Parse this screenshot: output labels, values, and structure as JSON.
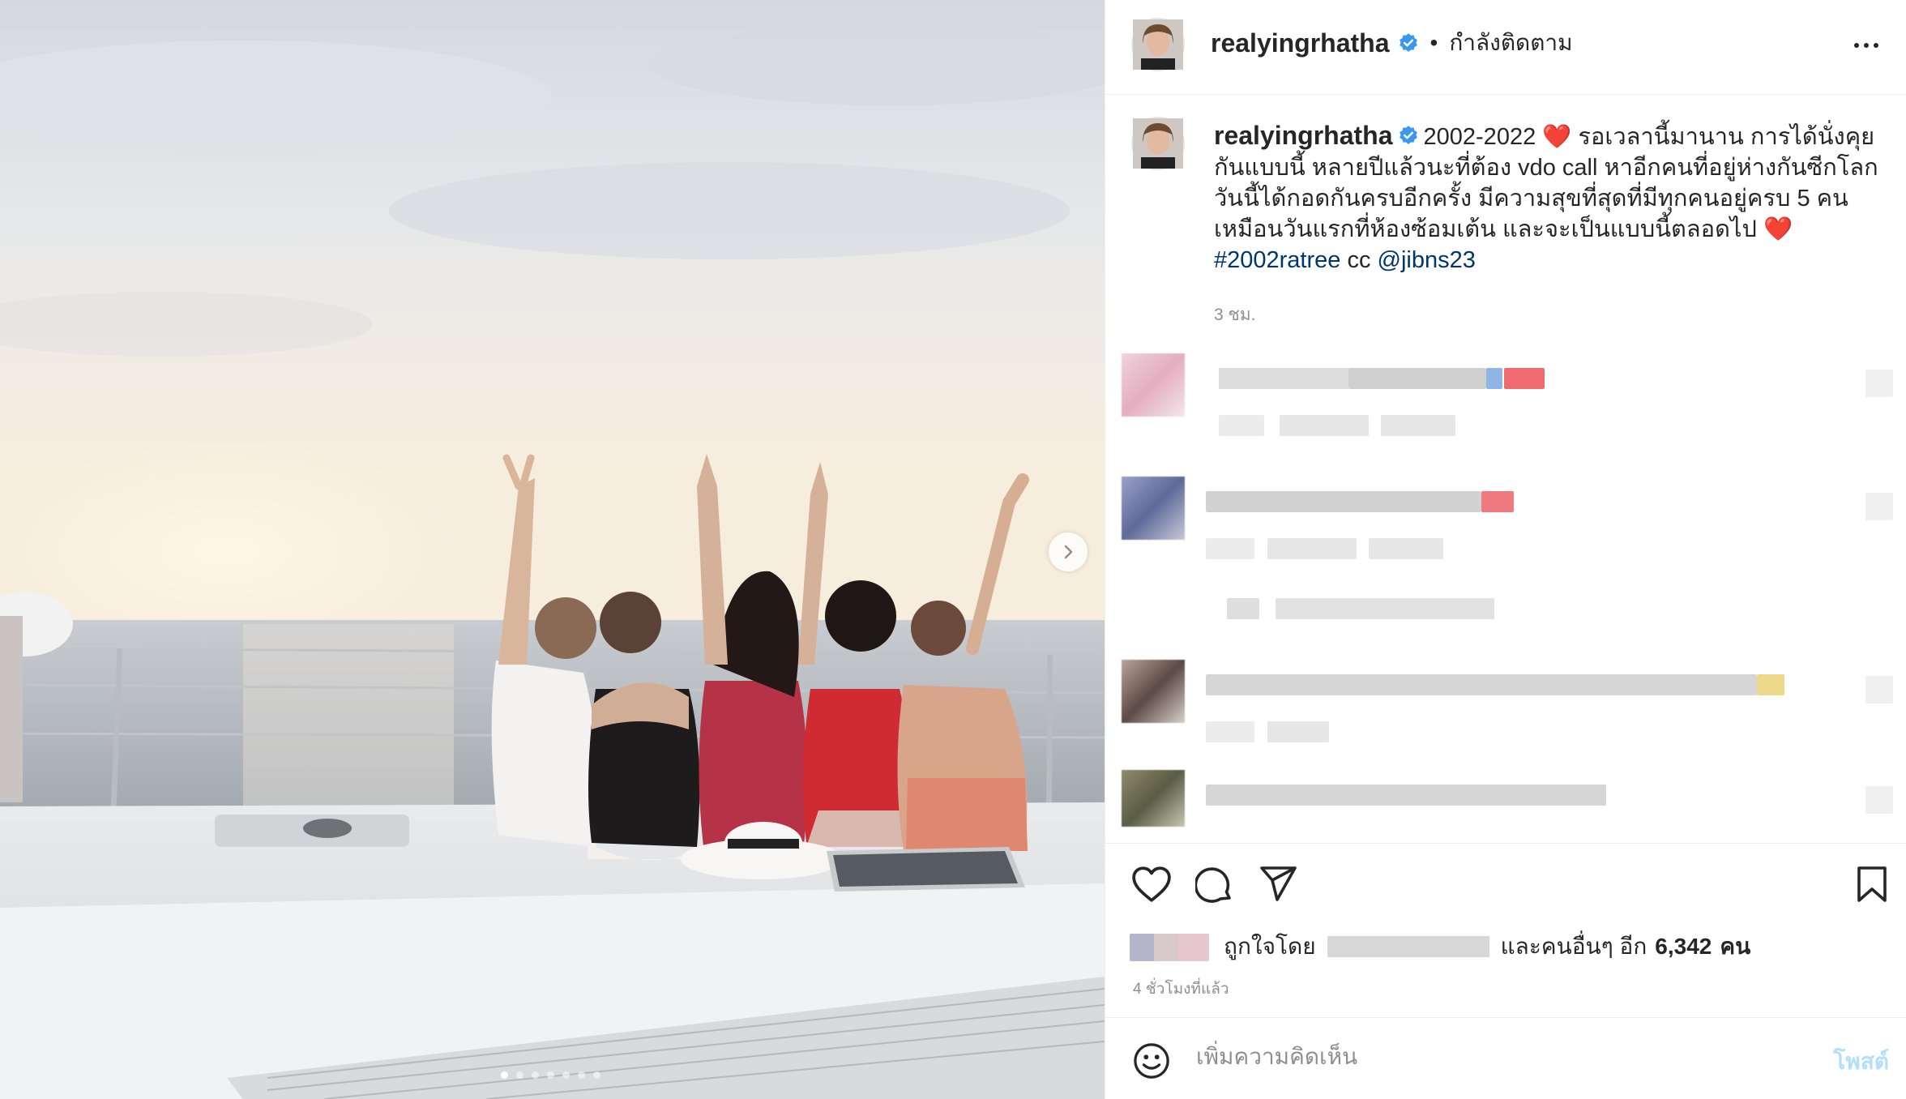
{
  "post": {
    "username": "realyingrhatha",
    "follow_status": "กำลังติดตาม",
    "separator": "•",
    "caption_text": "2002-2022 ❤️ รอเวลานี้มานาน การได้นั่งคุยกันแบบนี้ หลายปีแล้วนะที่ต้อง vdo call หาอีกคนที่อยู่ห่างกันซีกโลก วันนี้ได้กอดกันครบอีกครั้ง มีความสุขที่สุดที่มีทุกคนอยู่ครบ 5 คนเหมือนวันแรกที่ห้องซ้อมเต้น และจะเป็นแบบนี้ตลอดไป ❤️",
    "hashtag": "#2002ratree",
    "cc_label": "cc",
    "mention": "@jibns23",
    "caption_time": "3 ชม.",
    "likes_prefix": "ถูกใจโดย",
    "likes_middle": "และคนอื่นๆ อีก",
    "likes_count": "6,342",
    "likes_suffix": "คน",
    "posted_ago": "4 ชั่วโมงที่แล้ว",
    "comment_placeholder": "เพิ่มความคิดเห็น",
    "post_button": "โพสต์"
  },
  "carousel": {
    "total": 7,
    "current": 1
  },
  "colors": {
    "accent": "#0095f6",
    "verified": "#3897f0",
    "link": "#00376b",
    "muted": "#8e8e8e",
    "heart": "#ed4956"
  },
  "icons": [
    "heart-icon",
    "comment-icon",
    "share-icon",
    "bookmark-icon",
    "emoji-icon",
    "chevron-right-icon",
    "more-icon",
    "verified-icon"
  ]
}
